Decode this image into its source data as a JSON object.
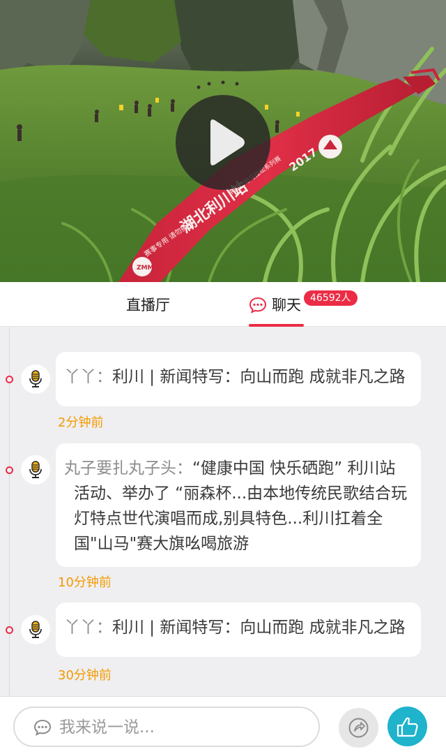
{
  "video": {
    "ribbon_year": "2017",
    "ribbon_main": "湖北利川站",
    "ribbon_sub": "中国山地马拉松系列赛",
    "ribbon_foot": "赛事专用 请勿撕除",
    "ribbon_logo": "ZMM"
  },
  "tabs": {
    "live_label": "直播厅",
    "chat_label": "聊天",
    "chat_count": "46592人"
  },
  "feed": [
    {
      "user": "丫丫：",
      "text": "利川 | 新闻特写：向山而跑 成就非凡之路",
      "time": "2分钟前"
    },
    {
      "user": "丸子要扎丸子头：",
      "text": "“健康中国 快乐硒跑” 利川站活动、举办了 “丽森杯...由本地传统民歌结合玩灯特点世代演唱而成,别具特色...利川扛着全国\"山马\"赛大旗吆喝旅游",
      "time": "10分钟前"
    },
    {
      "user": "丫丫：",
      "text": "利川 | 新闻特写：向山而跑 成就非凡之路",
      "time": "30分钟前"
    }
  ],
  "input": {
    "placeholder": "我来说一说..."
  },
  "colors": {
    "accent": "#ec2c45",
    "time": "#f39a00",
    "like": "#1fb3cc"
  },
  "icons": {
    "play": "play-icon",
    "chat": "chat-bubble-icon",
    "avatar": "microphone-icon",
    "comment": "comment-icon",
    "share": "share-icon",
    "like": "thumbs-up-icon"
  }
}
